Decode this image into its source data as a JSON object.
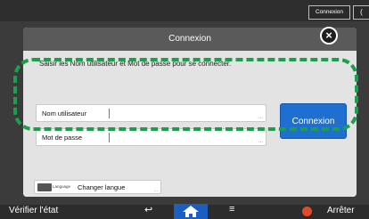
{
  "topbar": {
    "login_label": "Connexion",
    "extra_label": "("
  },
  "dialog": {
    "title": "Connexion",
    "close_label": "×",
    "instruction": "Saisir les Nom utilisateur et Mot de passe pour se connecter.",
    "fields": {
      "user_label": "Nom utilisateur",
      "pass_label": "Mot de passe",
      "user_more": "...",
      "pass_more": "..."
    },
    "login_button": "Connexion",
    "language": {
      "tag": "Language",
      "label": "Changer langue",
      "more": "..."
    }
  },
  "bottombar": {
    "verify_label": "Vérifier l'état",
    "back_glyph": "↩",
    "menu_glyph": "≡",
    "stop_label": "Arrêter"
  },
  "colors": {
    "accent": "#1f6fd1",
    "highlight": "#1aa04a",
    "stop": "#e14a2a"
  }
}
